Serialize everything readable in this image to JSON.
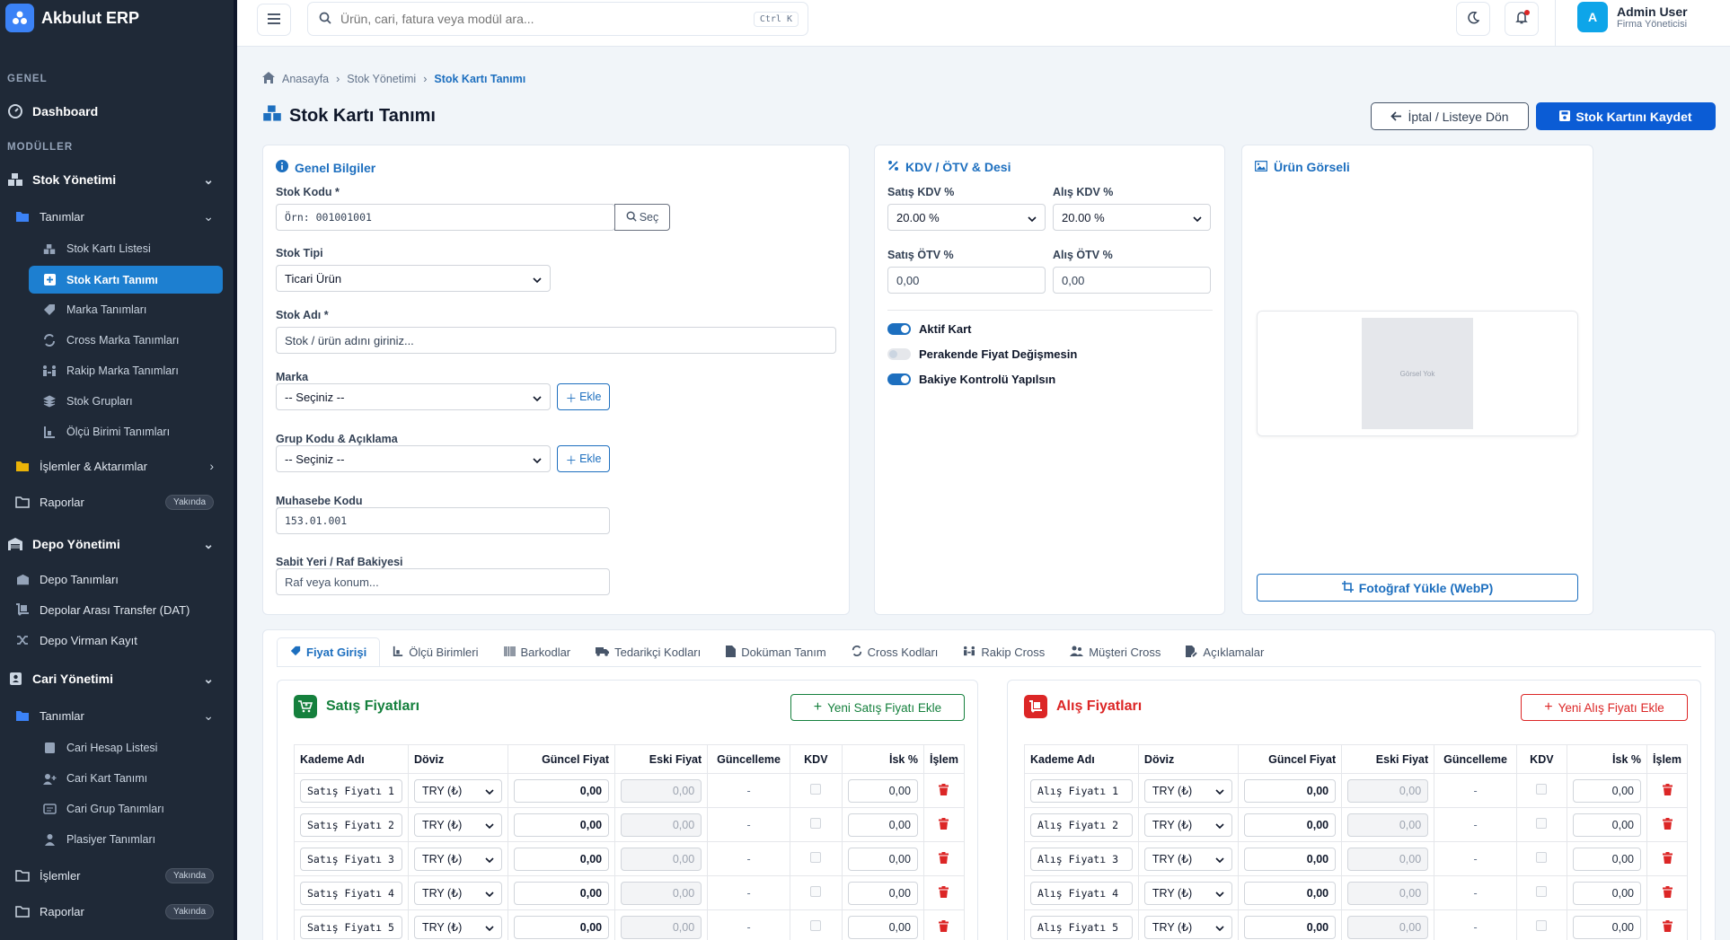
{
  "app": {
    "brand": "Akbulut ERP"
  },
  "sidebar": {
    "sections": {
      "general": "GENEL",
      "modules": "MODÜLLER"
    },
    "dashboard": "Dashboard",
    "stok": {
      "label": "Stok Yönetimi",
      "tanimlar": "Tanımlar",
      "items": [
        "Stok Kartı Listesi",
        "Stok Kartı Tanımı",
        "Marka Tanımları",
        "Cross Marka Tanımları",
        "Rakip Marka Tanımları",
        "Stok Grupları",
        "Ölçü Birimi Tanımları"
      ],
      "islemler": "İşlemler & Aktarımlar",
      "raporlar": "Raporlar"
    },
    "depo": {
      "label": "Depo Yönetimi",
      "items": [
        "Depo Tanımları",
        "Depolar Arası Transfer (DAT)",
        "Depo Virman Kayıt"
      ]
    },
    "cari": {
      "label": "Cari Yönetimi",
      "tanimlar": "Tanımlar",
      "items": [
        "Cari Hesap Listesi",
        "Cari Kart Tanımı",
        "Cari Grup Tanımları",
        "Plasiyer Tanımları"
      ],
      "islemler": "İşlemler",
      "raporlar": "Raporlar"
    },
    "soon": "Yakında"
  },
  "topbar": {
    "search_placeholder": "Ürün, cari, fatura veya modül ara...",
    "shortcut": "Ctrl K",
    "user_initial": "A",
    "user_name": "Admin User",
    "user_role": "Firma Yöneticisi"
  },
  "breadcrumb": [
    "Anasayfa",
    "Stok Yönetimi",
    "Stok Kartı Tanımı"
  ],
  "page": {
    "title": "Stok Kartı Tanımı",
    "cancel": "İptal / Listeye Dön",
    "save": "Stok Kartını Kaydet"
  },
  "general": {
    "title": "Genel Bilgiler",
    "stok_kodu_label": "Stok Kodu *",
    "stok_kodu_placeholder": "Örn: 001001001",
    "sec": "Seç",
    "stok_tipi_label": "Stok Tipi",
    "stok_tipi_value": "Ticari Ürün",
    "stok_adi_label": "Stok Adı *",
    "stok_adi_placeholder": "Stok / ürün adını giriniz...",
    "marka_label": "Marka",
    "marka_value": "-- Seçiniz --",
    "ekle": "Ekle",
    "grup_label": "Grup Kodu & Açıklama",
    "grup_value": "-- Seçiniz --",
    "muhasebe_label": "Muhasebe Kodu",
    "muhasebe_value": "153.01.001",
    "raf_label": "Sabit Yeri / Raf Bakiyesi",
    "raf_placeholder": "Raf veya konum..."
  },
  "kdv": {
    "title": "KDV / ÖTV & Desi",
    "satis_kdv_label": "Satış KDV %",
    "satis_kdv_value": "20.00 %",
    "alis_kdv_label": "Alış KDV %",
    "alis_kdv_value": "20.00 %",
    "satis_otv_label": "Satış ÖTV %",
    "satis_otv_value": "0,00",
    "alis_otv_label": "Alış ÖTV %",
    "alis_otv_value": "0,00",
    "toggles": [
      {
        "label": "Aktif Kart",
        "on": true
      },
      {
        "label": "Perakende Fiyat Değişmesin",
        "on": false
      },
      {
        "label": "Bakiye Kontrolü Yapılsın",
        "on": true
      }
    ]
  },
  "image": {
    "title": "Ürün Görseli",
    "empty": "Görsel Yok",
    "upload": "Fotoğraf Yükle (WebP)"
  },
  "tabs": [
    "Fiyat Girişi",
    "Ölçü Birimleri",
    "Barkodlar",
    "Tedarikçi Kodları",
    "Doküman Tanım",
    "Cross Kodları",
    "Rakip Cross",
    "Müşteri Cross",
    "Açıklamalar"
  ],
  "columns": [
    "Kademe Adı",
    "Döviz",
    "Güncel Fiyat",
    "Eski Fiyat",
    "Güncelleme",
    "KDV",
    "İsk %",
    "İşlem"
  ],
  "sales": {
    "title": "Satış Fiyatları",
    "new": "Yeni Satış Fiyatı Ekle",
    "rows": [
      {
        "name": "Satış Fiyatı 1",
        "currency": "TRY (₺)",
        "price": "0,00",
        "old": "0,00",
        "updated": "-",
        "disc": "0,00"
      },
      {
        "name": "Satış Fiyatı 2",
        "currency": "TRY (₺)",
        "price": "0,00",
        "old": "0,00",
        "updated": "-",
        "disc": "0,00"
      },
      {
        "name": "Satış Fiyatı 3",
        "currency": "TRY (₺)",
        "price": "0,00",
        "old": "0,00",
        "updated": "-",
        "disc": "0,00"
      },
      {
        "name": "Satış Fiyatı 4",
        "currency": "TRY (₺)",
        "price": "0,00",
        "old": "0,00",
        "updated": "-",
        "disc": "0,00"
      },
      {
        "name": "Satış Fiyatı 5",
        "currency": "TRY (₺)",
        "price": "0,00",
        "old": "0,00",
        "updated": "-",
        "disc": "0,00"
      }
    ]
  },
  "purchase": {
    "title": "Alış Fiyatları",
    "new": "Yeni Alış Fiyatı Ekle",
    "rows": [
      {
        "name": "Alış Fiyatı 1",
        "currency": "TRY (₺)",
        "price": "0,00",
        "old": "0,00",
        "updated": "-",
        "disc": "0,00"
      },
      {
        "name": "Alış Fiyatı 2",
        "currency": "TRY (₺)",
        "price": "0,00",
        "old": "0,00",
        "updated": "-",
        "disc": "0,00"
      },
      {
        "name": "Alış Fiyatı 3",
        "currency": "TRY (₺)",
        "price": "0,00",
        "old": "0,00",
        "updated": "-",
        "disc": "0,00"
      },
      {
        "name": "Alış Fiyatı 4",
        "currency": "TRY (₺)",
        "price": "0,00",
        "old": "0,00",
        "updated": "-",
        "disc": "0,00"
      },
      {
        "name": "Alış Fiyatı 5",
        "currency": "TRY (₺)",
        "price": "0,00",
        "old": "0,00",
        "updated": "-",
        "disc": "0,00"
      }
    ]
  },
  "colors": {
    "accent": "#1d6fbf",
    "primary": "#0b5cd5",
    "sales": "#15803d",
    "purchase": "#dc2626",
    "sidebar": "#1f2937"
  }
}
